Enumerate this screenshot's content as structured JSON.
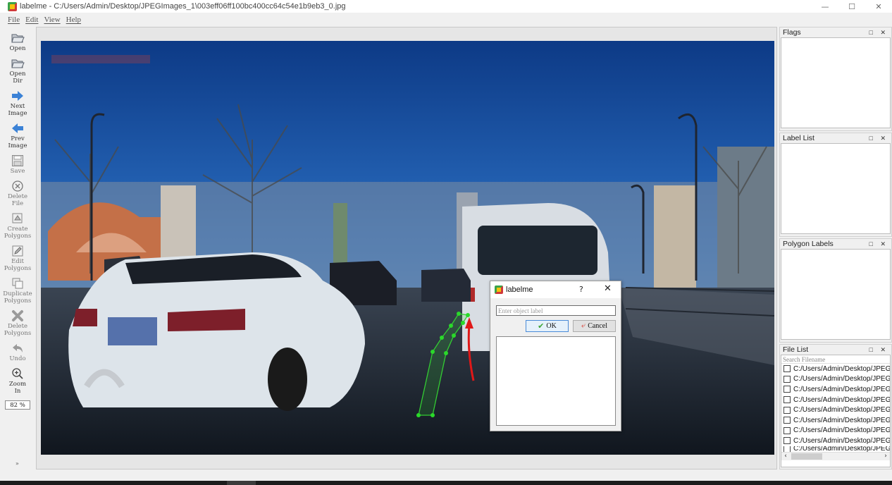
{
  "window": {
    "title": "labelme - C:/Users/Admin/Desktop/JPEGImages_1\\003eff06ff100bc400cc64c54e1b9eb3_0.jpg",
    "minimize": "—",
    "maximize": "☐",
    "close": "✕"
  },
  "menu": [
    "File",
    "Edit",
    "View",
    "Help"
  ],
  "toolbar": {
    "open": "Open",
    "open_dir": "Open\nDir",
    "next_image": "Next\nImage",
    "prev_image": "Prev\nImage",
    "save": "Save",
    "delete_file": "Delete\nFile",
    "create_polygons": "Create\nPolygons",
    "edit_polygons": "Edit\nPolygons",
    "duplicate_polygons": "Duplicate\nPolygons",
    "delete_polygons": "Delete\nPolygons",
    "undo": "Undo",
    "zoom_in": "Zoom\nIn",
    "zoom_value": "82 %",
    "more": "»"
  },
  "docks": {
    "flags": "Flags",
    "label_list": "Label List",
    "polygon_labels": "Polygon Labels",
    "file_list": "File List",
    "float_close": "□ ✕"
  },
  "file_list": {
    "search_placeholder": "Search Filename",
    "items": [
      "C:/Users/Admin/Desktop/JPEGI",
      "C:/Users/Admin/Desktop/JPEGI",
      "C:/Users/Admin/Desktop/JPEGI",
      "C:/Users/Admin/Desktop/JPEGI",
      "C:/Users/Admin/Desktop/JPEGI",
      "C:/Users/Admin/Desktop/JPEGI",
      "C:/Users/Admin/Desktop/JPEGI",
      "C:/Users/Admin/Desktop/JPEGI",
      "C:/Users/Admin/Desktop/JPEGI"
    ]
  },
  "dialog": {
    "title": "labelme",
    "help": "?",
    "close": "✕",
    "input_placeholder": "Enter object label",
    "ok": "OK",
    "cancel": "Cancel"
  }
}
